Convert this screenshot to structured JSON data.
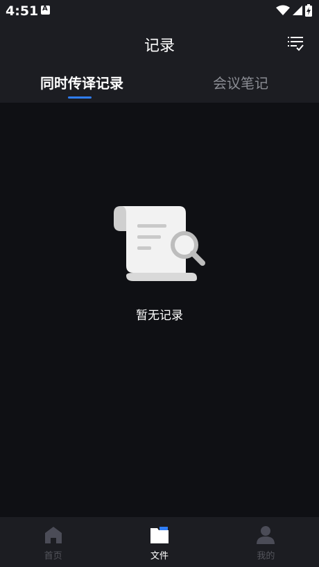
{
  "status_bar": {
    "time": "4:51",
    "notification_icon": "font-app-icon",
    "icons": [
      "wifi-icon",
      "signal-icon",
      "battery-charging-icon"
    ]
  },
  "header": {
    "title": "记录",
    "filter_icon": "filter-list-check-icon"
  },
  "tabs": [
    {
      "label": "同时传译记录",
      "active": true
    },
    {
      "label": "会议笔记",
      "active": false
    }
  ],
  "empty_state": {
    "icon": "scroll-search-icon",
    "message": "暂无记录"
  },
  "bottom_nav": [
    {
      "label": "首页",
      "icon": "home-icon",
      "active": false
    },
    {
      "label": "文件",
      "icon": "folder-icon",
      "active": true
    },
    {
      "label": "我的",
      "icon": "person-icon",
      "active": false
    }
  ],
  "colors": {
    "accent": "#2f7df6",
    "background": "#0f1014",
    "bar": "#1c1d22",
    "inactive_text": "#8a8c93"
  }
}
